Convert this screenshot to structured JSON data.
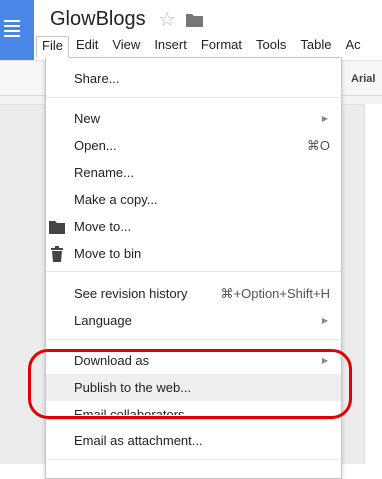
{
  "app": {
    "title": "GlowBlogs",
    "accent_color": "#4a86e8",
    "icon": "docs-app-icon"
  },
  "title_bar": {
    "star_icon": "☆",
    "folder_icon": "folder-icon"
  },
  "menubar": [
    "File",
    "Edit",
    "View",
    "Insert",
    "Format",
    "Tools",
    "Table",
    "Ac"
  ],
  "toolbar": {
    "font": "Arial"
  },
  "file_menu": {
    "share": "Share...",
    "new": "New",
    "open": "Open...",
    "open_shortcut": "⌘O",
    "rename": "Rename...",
    "make_copy": "Make a copy...",
    "move_to": "Move to...",
    "move_to_bin": "Move to bin",
    "revision_history": "See revision history",
    "revision_shortcut": "⌘+Option+Shift+H",
    "language": "Language",
    "download_as": "Download as",
    "publish": "Publish to the web...",
    "email_collaborators": "Email collaborators...",
    "email_attachment": "Email as attachment...",
    "submenu_arrow": "▶"
  },
  "annotation": {
    "color": "#e00000"
  }
}
